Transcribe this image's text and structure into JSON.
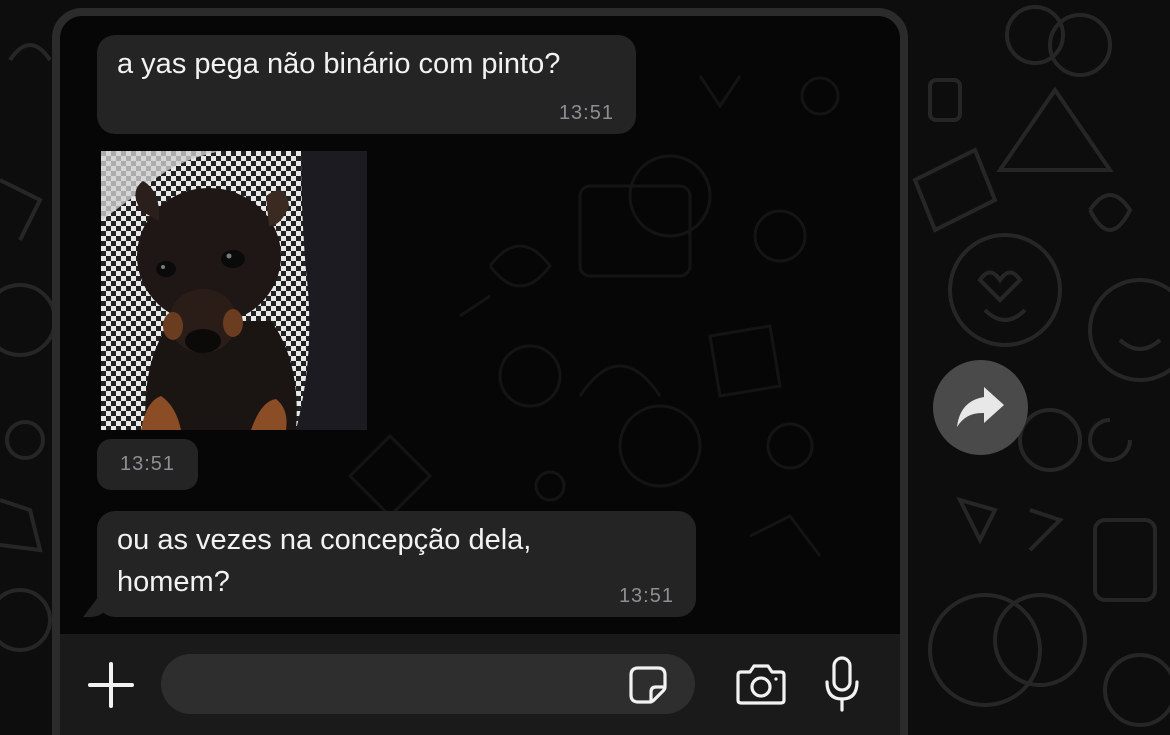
{
  "messages": [
    {
      "text": "a yas pega não binário com pinto?",
      "time": "13:51"
    },
    {
      "type": "sticker",
      "image": "puppy-sticker",
      "time": "13:51"
    },
    {
      "text": "ou as vezes na concepção dela,\nhomem?",
      "time": "13:51"
    }
  ],
  "composer": {
    "placeholder": "",
    "value": ""
  },
  "icons": {
    "attach": "plus-icon",
    "sticker": "sticker-icon",
    "camera": "camera-icon",
    "mic": "microphone-icon",
    "forward": "forward-arrow-icon"
  },
  "colors": {
    "background": "#0d0d0d",
    "bubble": "#242424",
    "text": "#f2f2f2",
    "timestamp": "#8e8e93",
    "input_bar": "#1a1a1a",
    "forward_button": "#4a4a4a"
  }
}
